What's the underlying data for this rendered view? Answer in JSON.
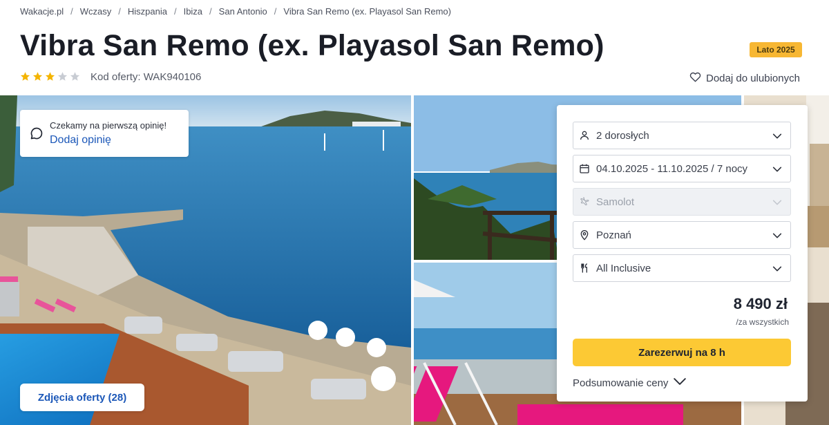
{
  "breadcrumb": [
    "Wakacje.pl",
    "Wczasy",
    "Hiszpania",
    "Ibiza",
    "San Antonio",
    "Vibra San Remo (ex. Playasol San Remo)"
  ],
  "title": "Vibra San Remo (ex. Playasol San Remo)",
  "season_badge": "Lato 2025",
  "rating": {
    "stars": 3,
    "max": 5
  },
  "offer_code": "Kod oferty: WAK940106",
  "favorite_label": "Dodaj do ulubionych",
  "review": {
    "waiting_text": "Czekamy na pierwszą opinię!",
    "add_label": "Dodaj opinię"
  },
  "photos_button": "Zdjęcia oferty (28)",
  "booking": {
    "travelers": "2 dorosłych",
    "dates": "04.10.2025 - 11.10.2025 / 7 nocy",
    "transport": "Samolot",
    "departure": "Poznań",
    "board": "All Inclusive",
    "price": "8 490 zł",
    "price_note": "/za wszystkich",
    "reserve_label": "Zarezerwuj na 8 h",
    "summary_label": "Podsumowanie ceny"
  },
  "colors": {
    "accent_yellow": "#fcc934",
    "badge_orange": "#f7b733",
    "link_blue": "#1b57b8",
    "star_gold": "#f4b400",
    "star_gray": "#c8ccd3"
  },
  "icons": [
    "star-icon",
    "heart-icon",
    "chat-bubble-icon",
    "person-icon",
    "calendar-icon",
    "plane-icon",
    "location-pin-icon",
    "cutlery-icon",
    "chevron-down-icon"
  ]
}
